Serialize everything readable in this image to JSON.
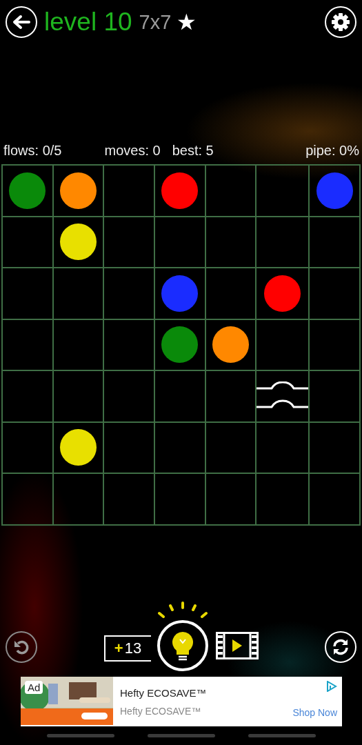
{
  "header": {
    "title": "level 10",
    "size": "7x7",
    "star": "★"
  },
  "stats": {
    "flows": "flows: 0/5",
    "moves": "moves: 0",
    "best": "best: 5",
    "pipe": "pipe: 0%"
  },
  "board": {
    "rows": [
      [
        {
          "kind": "dot",
          "color": "#0a8a0a"
        },
        {
          "kind": "dot",
          "color": "#ff8800"
        },
        {
          "kind": "empty"
        },
        {
          "kind": "dot",
          "color": "#ff0000"
        },
        {
          "kind": "empty"
        },
        {
          "kind": "empty"
        },
        {
          "kind": "dot",
          "color": "#1a2cff"
        }
      ],
      [
        {
          "kind": "empty"
        },
        {
          "kind": "dot",
          "color": "#e8e000"
        },
        {
          "kind": "empty"
        },
        {
          "kind": "empty"
        },
        {
          "kind": "empty"
        },
        {
          "kind": "empty"
        },
        {
          "kind": "empty"
        }
      ],
      [
        {
          "kind": "empty"
        },
        {
          "kind": "empty"
        },
        {
          "kind": "empty"
        },
        {
          "kind": "dot",
          "color": "#1a2cff"
        },
        {
          "kind": "empty"
        },
        {
          "kind": "dot",
          "color": "#ff0000"
        },
        {
          "kind": "empty"
        }
      ],
      [
        {
          "kind": "empty"
        },
        {
          "kind": "empty"
        },
        {
          "kind": "empty"
        },
        {
          "kind": "dot",
          "color": "#0a8a0a"
        },
        {
          "kind": "dot",
          "color": "#ff8800"
        },
        {
          "kind": "empty"
        },
        {
          "kind": "empty"
        }
      ],
      [
        {
          "kind": "empty"
        },
        {
          "kind": "empty"
        },
        {
          "kind": "empty"
        },
        {
          "kind": "empty"
        },
        {
          "kind": "empty"
        },
        {
          "kind": "bridge"
        },
        {
          "kind": "empty"
        }
      ],
      [
        {
          "kind": "empty"
        },
        {
          "kind": "dot",
          "color": "#e8e000"
        },
        {
          "kind": "empty"
        },
        {
          "kind": "empty"
        },
        {
          "kind": "empty"
        },
        {
          "kind": "empty"
        },
        {
          "kind": "empty"
        }
      ],
      [
        {
          "kind": "empty"
        },
        {
          "kind": "empty"
        },
        {
          "kind": "empty"
        },
        {
          "kind": "empty"
        },
        {
          "kind": "empty"
        },
        {
          "kind": "empty"
        },
        {
          "kind": "empty"
        }
      ]
    ]
  },
  "hints": {
    "plus": "+",
    "count": "13"
  },
  "ad": {
    "badge": "Ad",
    "title": "Hefty ECOSAVE™",
    "subtitle": "Hefty ECOSAVE™",
    "cta": "Shop Now"
  }
}
